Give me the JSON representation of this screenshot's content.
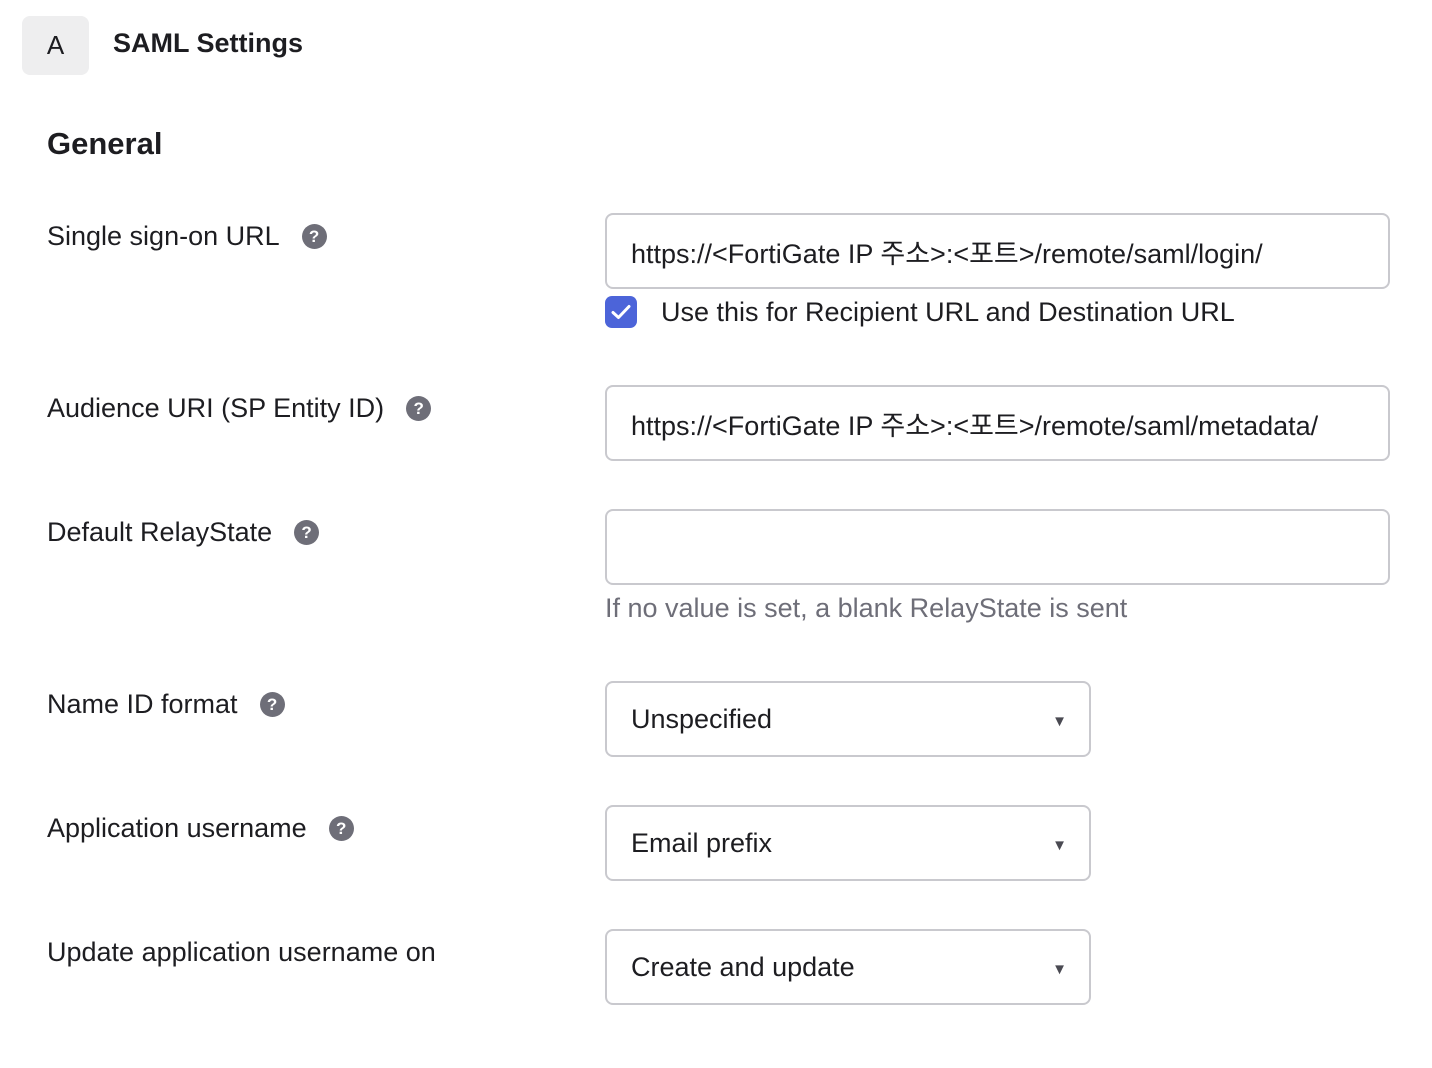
{
  "header": {
    "step_letter": "A",
    "title": "SAML Settings"
  },
  "section": {
    "heading": "General"
  },
  "fields": {
    "sso_url": {
      "label": "Single sign-on URL",
      "value": "https://<FortiGate IP 주소>:<포트>/remote/saml/login/",
      "checkbox_label": "Use this for Recipient URL and Destination URL",
      "checkbox_checked": true
    },
    "audience_uri": {
      "label": "Audience URI (SP Entity ID)",
      "value": "https://<FortiGate IP 주소>:<포트>/remote/saml/metadata/"
    },
    "relay_state": {
      "label": "Default RelayState",
      "value": "",
      "help": "If no value is set, a blank RelayState is sent"
    },
    "name_id_format": {
      "label": "Name ID format",
      "selected": "Unspecified"
    },
    "app_username": {
      "label": "Application username",
      "selected": "Email prefix"
    },
    "update_username_on": {
      "label": "Update application username on",
      "selected": "Create and update"
    }
  },
  "icons": {
    "help": "question-circle-icon",
    "caret": "caret-down-icon",
    "check": "checkmark-icon"
  },
  "colors": {
    "accent": "#4c64d9",
    "border": "#c9c9ce",
    "help_icon": "#6e6e78",
    "muted_text": "#6e6e78"
  }
}
